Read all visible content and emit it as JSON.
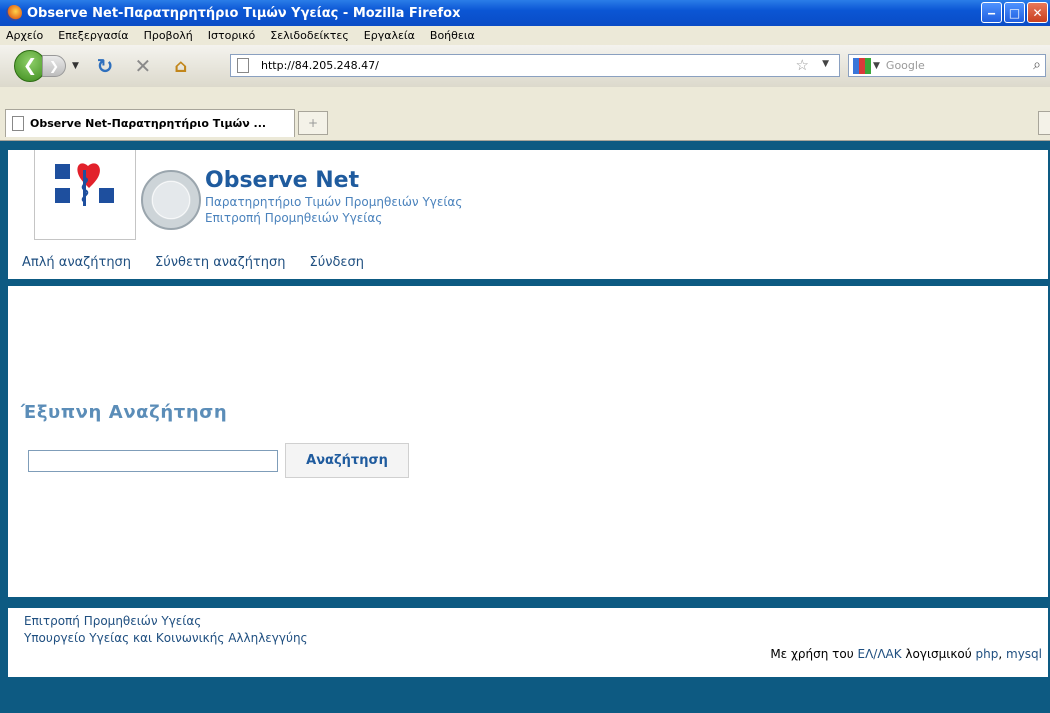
{
  "browser": {
    "title": "Observe Net-Παρατηρητήριο Τιμών Υγείας - Mozilla Firefox",
    "menu": [
      "Αρχείο",
      "Επεξεργασία",
      "Προβολή",
      "Ιστορικό",
      "Σελιδοδείκτες",
      "Εργαλεία",
      "Βοήθεια"
    ],
    "url": "http://84.205.248.47/",
    "search_placeholder": "Google",
    "tab_title": "Observe Net-Παρατηρητήριο Τιμών ...",
    "new_tab": "+"
  },
  "site": {
    "brand": "Observe Net",
    "subtitle_1": "Παρατηρητήριο Τιμών Προμηθειών Υγείας",
    "subtitle_2": "Επιτροπή Προμηθειών Υγείας",
    "nav": [
      "Απλή αναζήτηση",
      "Σύνθετη αναζήτηση",
      "Σύνδεση"
    ]
  },
  "search": {
    "title": "Έξυπνη Αναζήτηση",
    "input_value": "",
    "button_label": "Αναζήτηση"
  },
  "footer": {
    "line_1": "Επιτροπή Προμηθειών Υγείας",
    "line_2": "Υπουργείο Υγείας και Κοινωνικής Αλληλεγγύης",
    "credit_prefix": "Με χρήση του ",
    "credit_link_1": "ΕΛ/ΛΑΚ",
    "credit_mid": " λογισμικού ",
    "credit_link_2": "php",
    "credit_sep": ", ",
    "credit_link_3": "mysql"
  },
  "colors": {
    "page_frame": "#0d5a82",
    "brand_blue": "#1f5b9e",
    "search_title": "#5b8db8"
  }
}
